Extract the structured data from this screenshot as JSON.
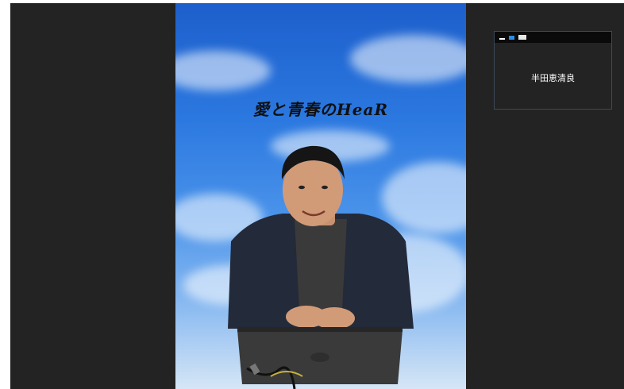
{
  "video": {
    "background_text": "愛と青春のHeaR"
  },
  "thumbnail": {
    "participant_name": "半田恵清良",
    "accent_color": "#2e8ce8"
  },
  "colors": {
    "window_bg": "#232323",
    "sky_top": "#1d5fcc",
    "sky_bottom": "#d6e6f6"
  }
}
